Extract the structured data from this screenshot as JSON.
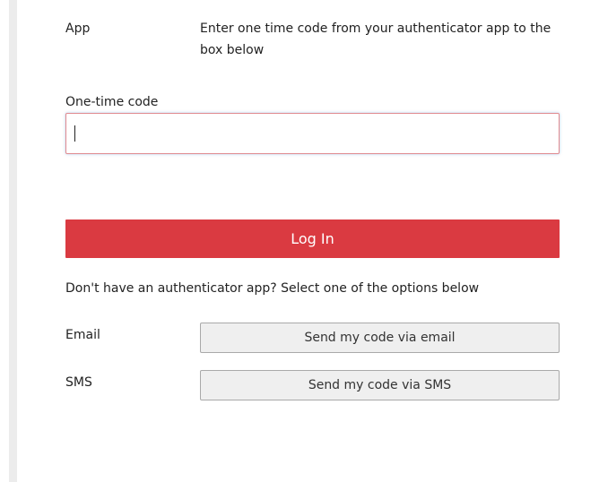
{
  "app_method": {
    "label": "App",
    "description": "Enter one time code from your authenticator app to the box below"
  },
  "code_field": {
    "label": "One-time code",
    "value": "",
    "placeholder": ""
  },
  "login_button": {
    "label": "Log In"
  },
  "alternatives": {
    "note": "Don't have an authenticator app? Select one of the options below",
    "email": {
      "label": "Email",
      "button_label": "Send my code via email"
    },
    "sms": {
      "label": "SMS",
      "button_label": "Send my code via SMS"
    }
  },
  "colors": {
    "primary_button": "#da3a41",
    "input_border_focus": "#e08a8f",
    "secondary_button_bg": "#efefef"
  }
}
